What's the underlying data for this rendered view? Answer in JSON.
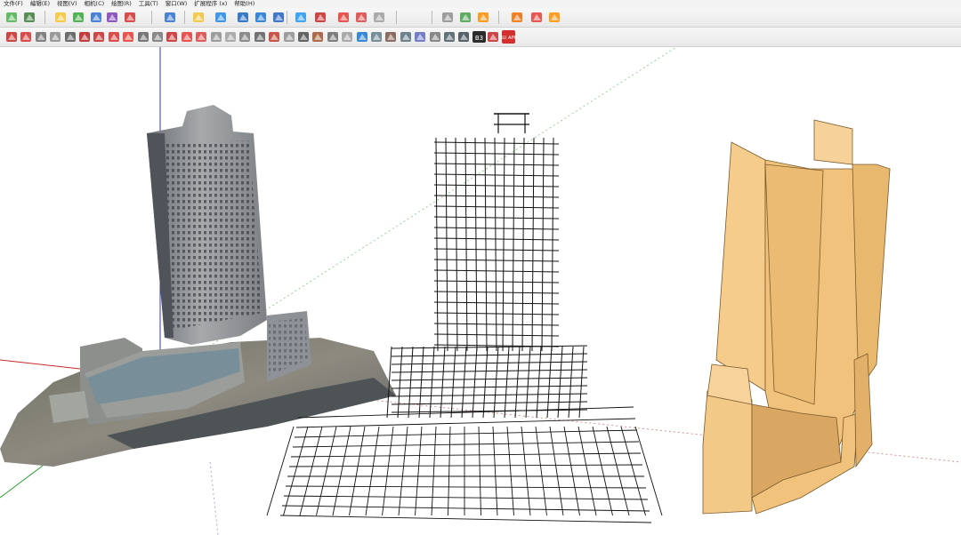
{
  "menubar": {
    "items": [
      "文件(F)",
      "编辑(E)",
      "视图(V)",
      "相机(C)",
      "绘图(R)",
      "工具(T)",
      "窗口(W)",
      "扩展程序 (x)",
      "帮助(H)"
    ]
  },
  "toolbar1": {
    "icons": [
      "book-icon",
      "arrow-box-icon",
      "house-yellow-icon",
      "house-green-icon",
      "cube-blue-icon",
      "gem-purple-icon",
      "target-icon",
      "scale-icon",
      "arrow-yellow-icon",
      "triangle-blue-icon",
      "bar-blue-icon",
      "arrows-updown-icon",
      "pipe-icon",
      "flip-icon",
      "rotate-ccw-icon",
      "rotate-cw-icon",
      "door-icon",
      "shield-icon",
      "key-icon",
      "triangle-green-icon",
      "download-icon",
      "layers-icon",
      "house-red-icon",
      "gears-icon"
    ]
  },
  "toolbar2": {
    "icons": [
      "line-tool-icon",
      "rectangle-tool-icon",
      "circle-tool-icon",
      "arc-tool-icon",
      "offset-tool-icon",
      "push-pull-icon",
      "move-icon",
      "rotate-icon",
      "scale-tool-icon",
      "tape-measure-icon",
      "protractor-icon",
      "check-icon",
      "paint-bucket-icon",
      "eraser-icon",
      "text-icon",
      "dimension-icon",
      "axes-icon",
      "section-plane-icon",
      "orbit-icon",
      "pan-icon",
      "zoom-icon",
      "zoom-extents-icon",
      "sun-icon",
      "shadow-icon",
      "fog-icon",
      "match-photo-icon",
      "walk-icon",
      "look-around-icon",
      "position-camera-icon",
      "layer-icon",
      "outliner-icon",
      "styles-icon",
      "b3-icon",
      "sketchup-logo-icon",
      "su-app-icon"
    ],
    "badges": {
      "b3": "B3",
      "su_app": "SU APP"
    }
  },
  "colors": {
    "axis_red": "#c62828",
    "axis_green": "#2e9d2e",
    "axis_blue": "#3333cc",
    "model_fill": "#f0c27b",
    "model_shade": "#c79a55",
    "toolbar_bg": "#ececec"
  },
  "viewport": {
    "models": [
      "photo-mesh-building",
      "point-cloud-wireframe",
      "massing-solid-model"
    ]
  }
}
